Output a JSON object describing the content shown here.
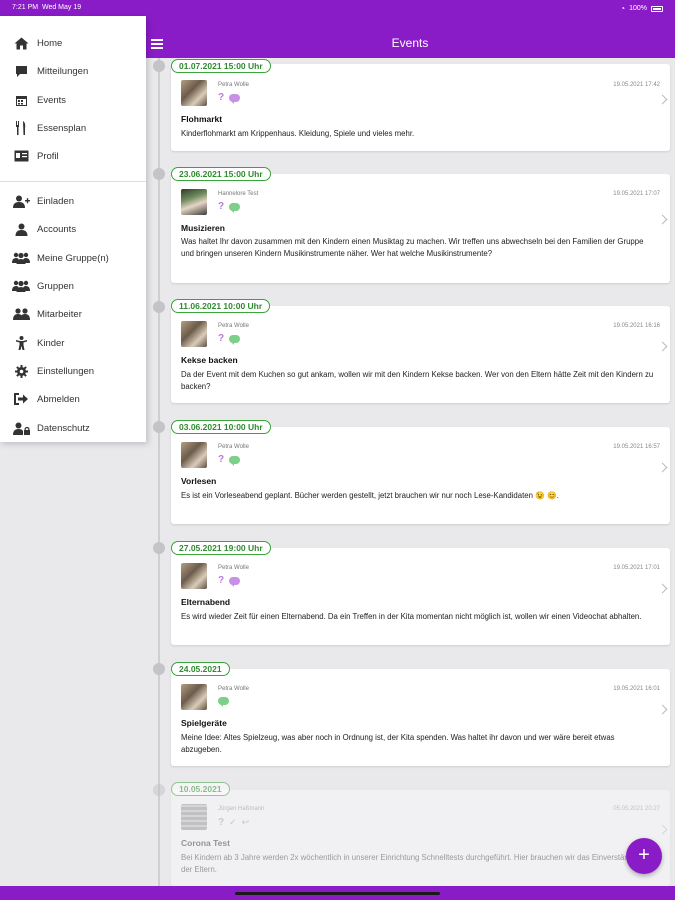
{
  "status_bar": {
    "time": "7:21 PM",
    "date": "Wed May 19",
    "battery": "100%"
  },
  "header": {
    "title": "Events"
  },
  "sidebar": {
    "items": [
      {
        "label": "Home",
        "icon": "home-icon"
      },
      {
        "label": "Mitteilungen",
        "icon": "message-icon"
      },
      {
        "label": "Events",
        "icon": "calendar-icon"
      },
      {
        "label": "Essensplan",
        "icon": "cutlery-icon"
      },
      {
        "label": "Profil",
        "icon": "id-card-icon"
      },
      {
        "label": "Einladen",
        "icon": "user-plus-icon"
      },
      {
        "label": "Accounts",
        "icon": "user-icon"
      },
      {
        "label": "Meine Gruppe(n)",
        "icon": "users-icon"
      },
      {
        "label": "Gruppen",
        "icon": "users-icon"
      },
      {
        "label": "Mitarbeiter",
        "icon": "user-group-icon"
      },
      {
        "label": "Kinder",
        "icon": "child-icon"
      },
      {
        "label": "Einstellungen",
        "icon": "gear-icon"
      },
      {
        "label": "Abmelden",
        "icon": "logout-icon"
      },
      {
        "label": "Datenschutz",
        "icon": "user-lock-icon"
      }
    ]
  },
  "events": [
    {
      "date": "01.07.2021 15:00 Uhr",
      "author": "Petra Wolle",
      "timestamp": "19.05.2021 17:42",
      "title": "Flohmarkt",
      "text": "Kinderflohmarkt am Krippenhaus. Kleidung, Spiele und vieles mehr."
    },
    {
      "date": "23.06.2021 15:00 Uhr",
      "author": "Hannelore Test",
      "timestamp": "19.05.2021 17:07",
      "title": "Musizieren",
      "text": "Was haltet Ihr davon zusammen mit den Kindern einen Musiktag zu machen. Wir treffen uns abwechseln bei den Familien der Gruppe und bringen unseren Kindern Musikinstrumente näher. Wer hat welche Musikinstrumente?"
    },
    {
      "date": "11.06.2021 10:00 Uhr",
      "author": "Petra Wolle",
      "timestamp": "19.05.2021 16:16",
      "title": "Kekse backen",
      "text": "Da der Event mit dem Kuchen so gut ankam, wollen wir mit den Kindern Kekse backen. Wer von den Eltern hätte Zeit mit den Kindern zu backen?"
    },
    {
      "date": "03.06.2021 10:00 Uhr",
      "author": "Petra Wolle",
      "timestamp": "19.05.2021 16:57",
      "title": "Vorlesen",
      "text": "Es ist ein Vorleseabend geplant. Bücher werden gestellt, jetzt brauchen wir nur noch Lese-Kandidaten 😉 😊."
    },
    {
      "date": "27.05.2021 19:00 Uhr",
      "author": "Petra Wolle",
      "timestamp": "19.05.2021 17:01",
      "title": "Elternabend",
      "text": "Es wird wieder Zeit für einen Elternabend. Da ein Treffen in der Kita momentan nicht möglich ist, wollen wir einen Videochat abhalten."
    },
    {
      "date": "24.05.2021",
      "author": "Petra Wolle",
      "timestamp": "19.05.2021 16:01",
      "title": "Spielgeräte",
      "text": "Meine Idee: Altes Spielzeug, was aber noch in Ordnung ist, der Kita spenden. Was haltet ihr davon und wer wäre bereit etwas abzugeben."
    },
    {
      "date": "10.05.2021",
      "author": "Jürgen Haßmann",
      "timestamp": "05.05.2021 20:27",
      "title": "Corona Test",
      "text": "Bei Kindern ab 3 Jahre werden 2x wöchentlich in unserer Einrichtung Schnelltests durchgeführt. Hier brauchen wir das Einverständnis der Eltern."
    }
  ],
  "fab": {
    "label": "+"
  },
  "colors": {
    "accent": "#8a1cc8",
    "date_green": "#2f8a2f"
  }
}
